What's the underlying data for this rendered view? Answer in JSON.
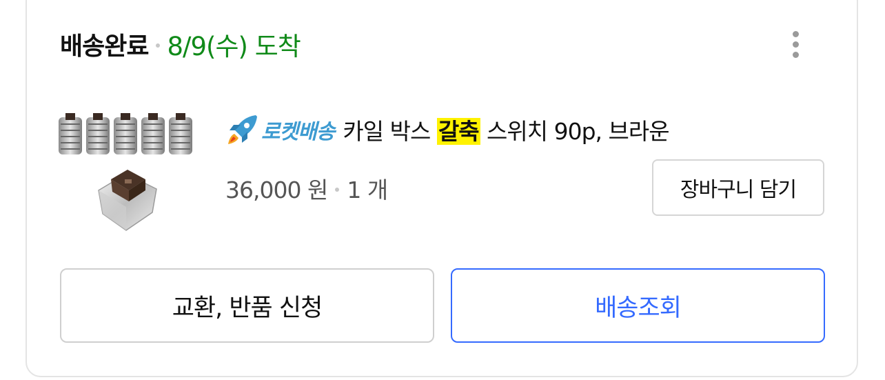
{
  "order": {
    "status_label": "배송완료",
    "delivery_date": "8/9(수) 도착"
  },
  "product": {
    "badge_text": "로켓배송",
    "name_before": "카일 박스 ",
    "name_highlight": "갈축",
    "name_after": " 스위치 90p, 브라운",
    "price": "36,000 원",
    "quantity": "1 개"
  },
  "actions": {
    "cart_label": "장바구니 담기",
    "return_label": "교환, 반품 신청",
    "track_label": "배송조회"
  },
  "icons": {
    "more": "more-vertical-icon",
    "rocket": "rocket-icon"
  },
  "colors": {
    "delivery_green": "#108a19",
    "rocket_blue": "#3d9bd1",
    "highlight_yellow": "#fff200",
    "track_blue": "#346aff"
  }
}
